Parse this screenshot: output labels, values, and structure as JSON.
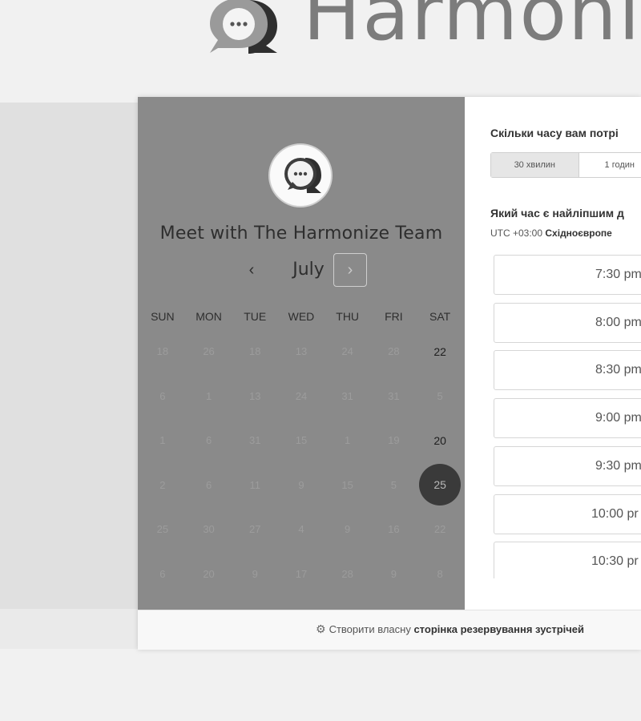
{
  "header": {
    "brand": "Harmoni"
  },
  "calendar": {
    "title": "Meet with The Harmonize Team",
    "month": "July",
    "prev_icon": "‹",
    "next_icon": "›",
    "weekdays": [
      "SUN",
      "MON",
      "TUE",
      "WED",
      "THU",
      "FRI",
      "SAT"
    ],
    "weeks": [
      [
        "18",
        "26",
        "18",
        "13",
        "24",
        "28",
        "22"
      ],
      [
        "6",
        "1",
        "13",
        "24",
        "31",
        "31",
        "5"
      ],
      [
        "1",
        "6",
        "31",
        "15",
        "1",
        "19",
        "20"
      ],
      [
        "2",
        "6",
        "11",
        "9",
        "15",
        "5",
        "25"
      ],
      [
        "25",
        "30",
        "27",
        "4",
        "9",
        "16",
        "22"
      ],
      [
        "6",
        "20",
        "9",
        "17",
        "28",
        "9",
        "8"
      ]
    ],
    "available_days": [
      "22",
      "20",
      "25"
    ],
    "selected_day": "25"
  },
  "booking": {
    "duration_question": "Скільки часу вам потрі",
    "durations": [
      "30 хвилин",
      "1 годин"
    ],
    "active_duration": "30 хвилин",
    "time_question": "Який час є найліпшим д",
    "timezone_prefix": "UTC +03:00",
    "timezone_name": "Східноєвропе",
    "slots": [
      "7:30 pm",
      "8:00 pm",
      "8:30 pm",
      "9:00 pm",
      "9:30 pm",
      "10:00 pr",
      "10:30 pr"
    ]
  },
  "footer": {
    "prefix": "Створити власну",
    "bold": "сторінка резервування зустрічей",
    "icon": "hubspot-sprocket-icon"
  },
  "colors": {
    "calendar_panel": "#8a8a8a",
    "selected_day": "#3a3a3a",
    "background": "#f1f1f1"
  }
}
